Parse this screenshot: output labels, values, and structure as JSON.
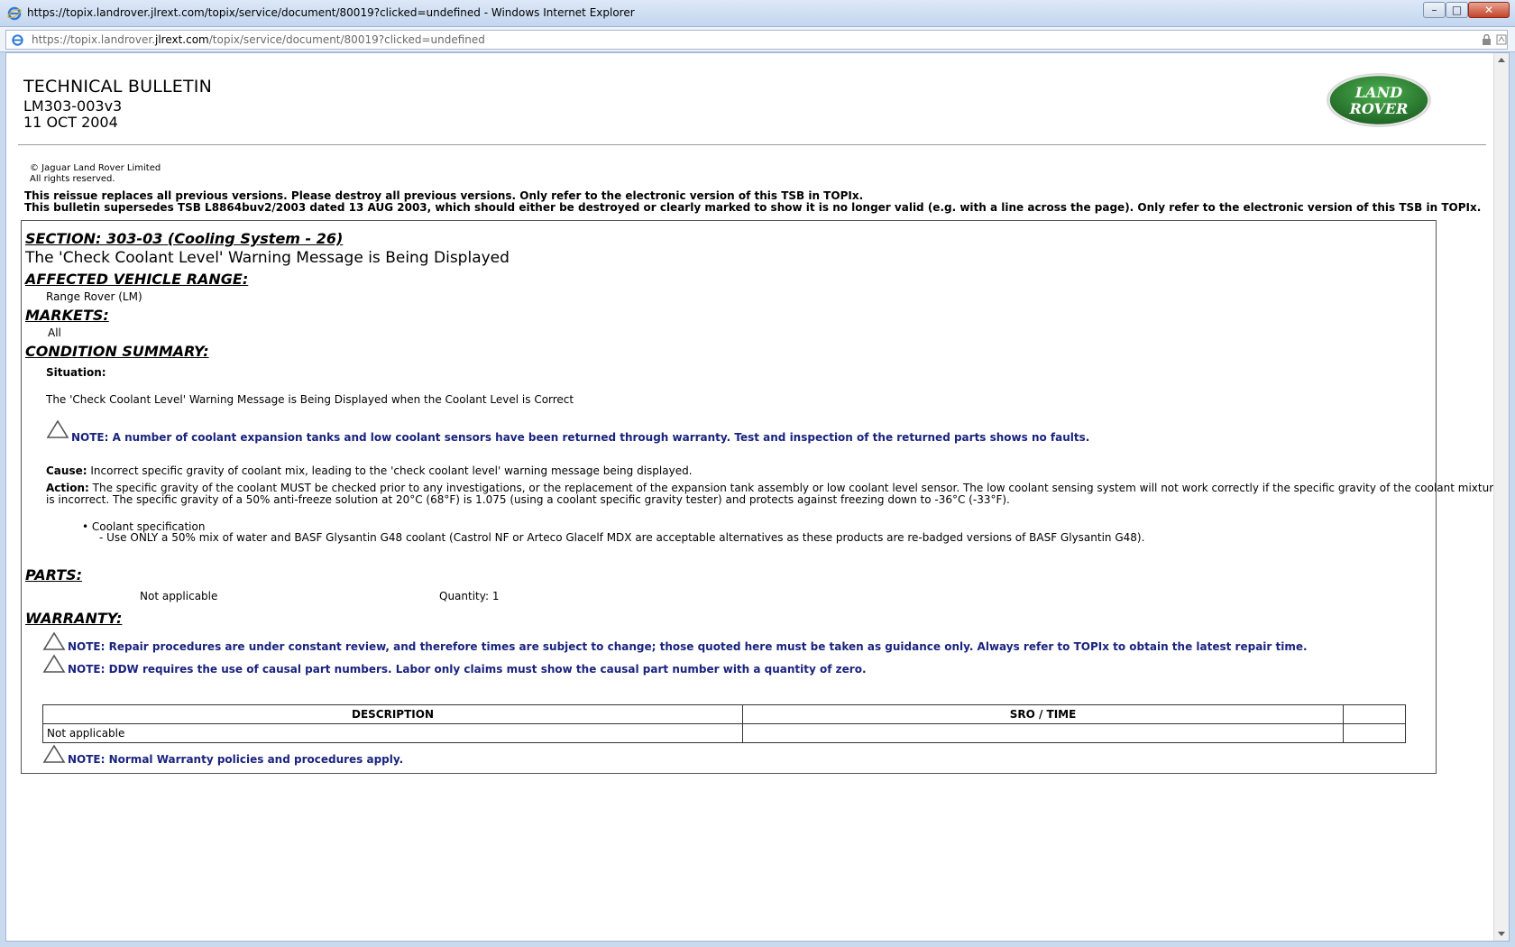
{
  "window": {
    "title": "https://topix.landrover.jlrext.com/topix/service/document/80019?clicked=undefined - Windows Internet Explorer",
    "min_glyph": "–",
    "max_glyph": "□",
    "close_glyph": "✕"
  },
  "address": {
    "url_prefix": "https://topix.landrover.",
    "url_host": "jlrext.com",
    "url_suffix": "/topix/service/document/80019?clicked=undefined"
  },
  "bulletin": {
    "title": "TECHNICAL BULLETIN",
    "id": "LM303-003v3",
    "date": "11 OCT 2004",
    "logo_line1": "LAND",
    "logo_line2": "ROVER",
    "copyright_line1": "© Jaguar Land Rover Limited",
    "copyright_line2": "All rights reserved.",
    "reissue_line1": "This reissue replaces all previous versions. Please destroy all previous versions. Only refer to the electronic version of this TSB in TOPIx.",
    "reissue_line2": "This bulletin supersedes TSB L8864buv2/2003 dated 13 AUG 2003, which should either be destroyed or clearly marked to show it is no longer valid (e.g. with a line across the page). Only refer to the electronic version of this TSB in TOPIx."
  },
  "section": {
    "heading": "SECTION: 303-03 (Cooling System - 26)",
    "subject": "The 'Check Coolant Level' Warning Message is Being Displayed"
  },
  "affected": {
    "heading": "AFFECTED VEHICLE RANGE:",
    "value": "Range Rover (LM)"
  },
  "markets": {
    "heading": "MARKETS:",
    "value": "All"
  },
  "condition": {
    "heading": "CONDITION SUMMARY:",
    "situation_label": "Situation:",
    "situation_text": "The 'Check Coolant Level' Warning Message is Being Displayed when the Coolant Level is Correct",
    "note": "NOTE: A number of coolant expansion tanks and low coolant sensors have been returned through warranty. Test and inspection of the returned parts shows no faults.",
    "cause_label": "Cause:",
    "cause_text": "Incorrect specific gravity of coolant mix, leading to the 'check coolant level' warning message being displayed.",
    "action_label": "Action:",
    "action_text_line1": "The specific gravity of the coolant MUST be checked prior to any investigations, or the replacement of the expansion tank assembly or low coolant level sensor. The low coolant sensing system will not work correctly if the specific gravity of the coolant mixture",
    "action_text_line2": "is incorrect. The specific gravity of a 50% anti-freeze solution at 20°C (68°F) is 1.075 (using a coolant specific gravity tester) and protects against freezing down to -36°C (-33°F).",
    "bullet": "• Coolant specification",
    "bullet_sub": "- Use ONLY a 50% mix of water and BASF Glysantin G48 coolant (Castrol NF or Arteco Glacelf MDX are acceptable alternatives as these products are re-badged versions of BASF Glysantin G48)."
  },
  "parts": {
    "heading": "PARTS:",
    "description": "Not applicable",
    "quantity": "Quantity: 1"
  },
  "warranty": {
    "heading": "WARRANTY:",
    "note1": "NOTE: Repair procedures are under constant review, and therefore times are subject to change; those quoted here must be taken as guidance only. Always refer to TOPIx to obtain the latest repair time.",
    "note2": "NOTE: DDW requires the use of causal part numbers. Labor only claims must show the causal part number with a quantity of zero.",
    "table": {
      "headers": [
        "DESCRIPTION",
        "SRO / TIME",
        ""
      ],
      "rows": [
        [
          "Not applicable",
          "",
          ""
        ]
      ]
    },
    "note3": "NOTE: Normal Warranty policies and procedures apply."
  },
  "colors": {
    "note_text": "#1a237e",
    "logo_green": "#2e7d32"
  }
}
